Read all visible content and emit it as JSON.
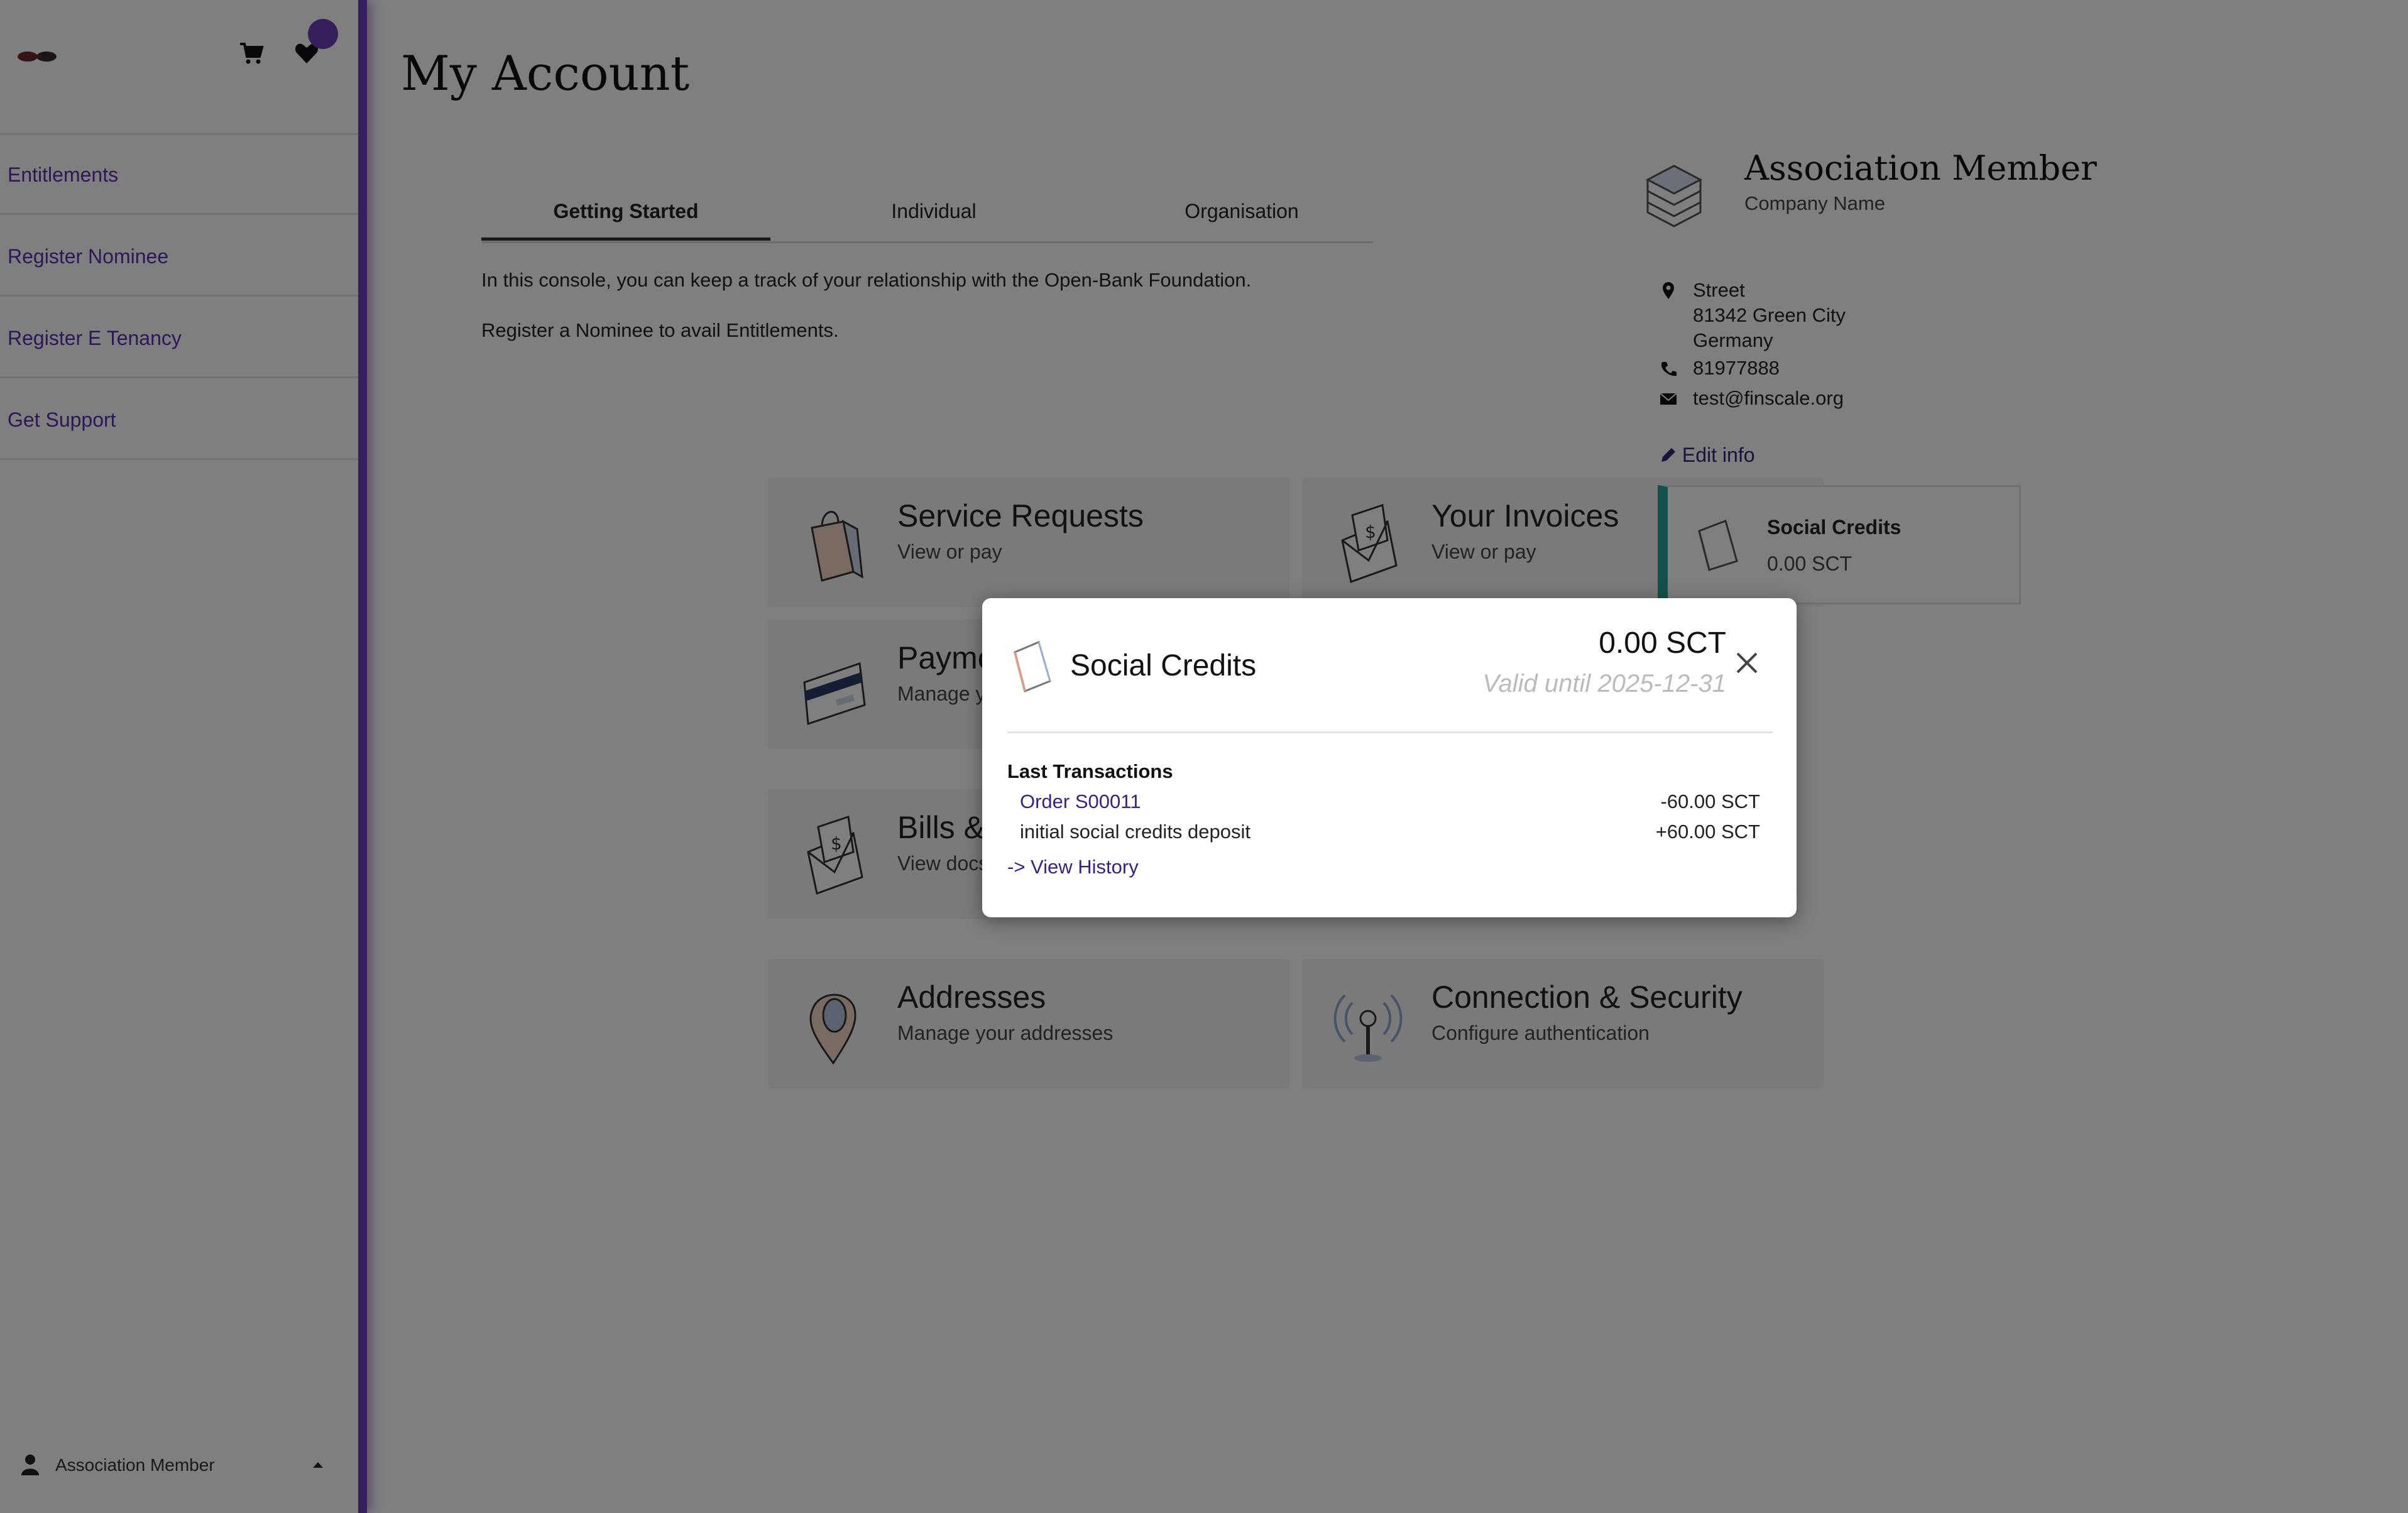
{
  "sidebar": {
    "items": [
      {
        "label": "Entitlements"
      },
      {
        "label": "Register Nominee"
      },
      {
        "label": "Register E Tenancy"
      },
      {
        "label": "Get Support"
      }
    ],
    "user_label": "Association Member"
  },
  "main": {
    "title": "My Account",
    "tabs": [
      {
        "label": "Getting Started"
      },
      {
        "label": "Individual"
      },
      {
        "label": "Organisation"
      }
    ],
    "intro_lines": [
      "In this console, you can keep a track of your relationship with the Open-Bank Foundation.",
      "Register a Nominee to avail Entitlements."
    ],
    "cards": [
      {
        "title": "Service Requests",
        "subtitle": "View or pay"
      },
      {
        "title": "Your Invoices",
        "subtitle": "View or pay"
      },
      {
        "title": "Payme",
        "subtitle": "Manage y"
      },
      {
        "title": "Bills &",
        "subtitle": "View docs"
      },
      {
        "title": "Addresses",
        "subtitle": "Manage your addresses"
      },
      {
        "title": "Connection & Security",
        "subtitle": "Configure authentication"
      }
    ]
  },
  "profile": {
    "title": "Association Member",
    "company": "Company Name",
    "street": "Street",
    "city": "81342 Green City",
    "country": "Germany",
    "phone": "81977888",
    "email": "test@finscale.org",
    "edit_label": "Edit info",
    "credits_card": {
      "title": "Social Credits",
      "value": "0.00 SCT"
    }
  },
  "modal": {
    "title": "Social Credits",
    "amount": "0.00 SCT",
    "valid_until": "Valid until 2025-12-31",
    "last_transactions_label": "Last Transactions",
    "transactions": [
      {
        "label": "Order S00011",
        "amount": "-60.00 SCT"
      },
      {
        "label": "initial social credits deposit",
        "amount": "+60.00 SCT"
      }
    ],
    "view_history_label": "-> View History"
  },
  "colors": {
    "accent": "#6a3fb8",
    "link": "#3a237a",
    "credits_stripe": "#2aa198",
    "overlay": "rgba(0,0,0,0.5)"
  }
}
